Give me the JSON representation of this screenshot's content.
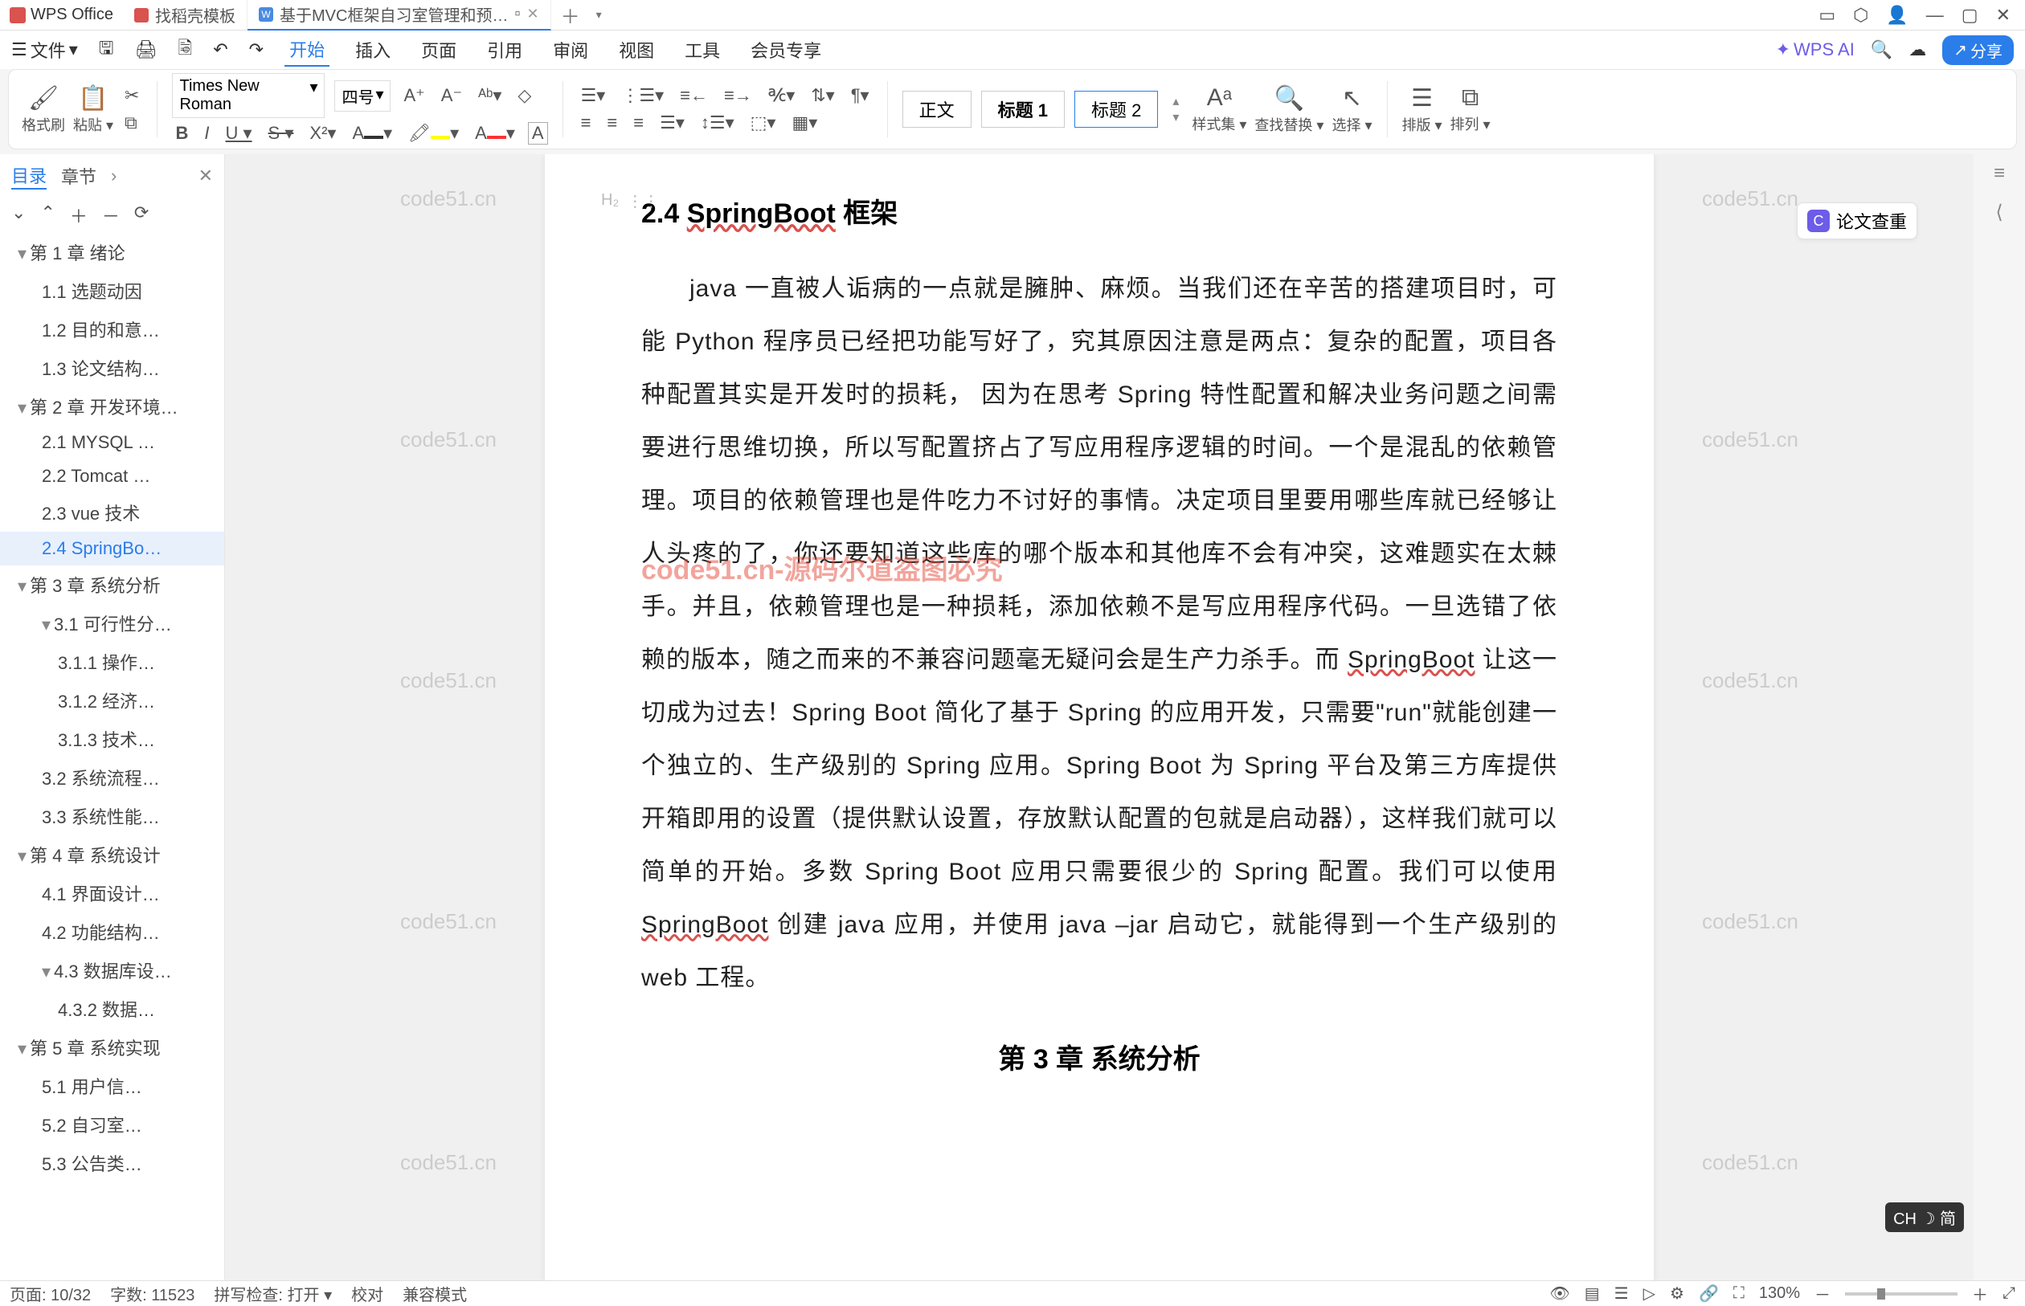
{
  "app": {
    "name": "WPS Office"
  },
  "tabs": [
    {
      "label": "找稻壳模板",
      "type": "d"
    },
    {
      "label": "基于MVC框架自习室管理和预…",
      "type": "w",
      "active": true
    }
  ],
  "windowControls": {
    "min": "—",
    "max": "▢",
    "close": "✕"
  },
  "menubar": {
    "file": "文件",
    "items": [
      "开始",
      "插入",
      "页面",
      "引用",
      "审阅",
      "视图",
      "工具",
      "会员专享"
    ],
    "active_index": 0,
    "wps_ai": "WPS AI",
    "share": "分享"
  },
  "ribbon": {
    "format_painter": "格式刷",
    "paste": "粘贴",
    "font_name": "Times New Roman",
    "font_size": "四号",
    "styles": {
      "body": "正文",
      "heading1": "标题 1",
      "heading2": "标题 2"
    },
    "styleset": "样式集",
    "find_replace": "查找替换",
    "select": "选择",
    "arrange": "排版",
    "order": "排列"
  },
  "sidebar": {
    "tabs": {
      "toc": "目录",
      "chapters": "章节"
    },
    "tree": [
      {
        "lvl": 0,
        "label": "第 1 章  绪论",
        "caret": true
      },
      {
        "lvl": 1,
        "label": "1.1 选题动因"
      },
      {
        "lvl": 1,
        "label": "1.2 目的和意…"
      },
      {
        "lvl": 1,
        "label": "1.3 论文结构…"
      },
      {
        "lvl": 0,
        "label": "第 2 章  开发环境…",
        "caret": true
      },
      {
        "lvl": 1,
        "label": "2.1 MYSQL …"
      },
      {
        "lvl": 1,
        "label": "2.2 Tomcat …"
      },
      {
        "lvl": 1,
        "label": "2.3 vue 技术"
      },
      {
        "lvl": 1,
        "label": "2.4 SpringBo…",
        "active": true
      },
      {
        "lvl": 0,
        "label": "第 3 章  系统分析",
        "caret": true
      },
      {
        "lvl": 1,
        "label": "3.1 可行性分…",
        "caret": true
      },
      {
        "lvl": 2,
        "label": "3.1.1 操作…"
      },
      {
        "lvl": 2,
        "label": "3.1.2 经济…"
      },
      {
        "lvl": 2,
        "label": "3.1.3 技术…"
      },
      {
        "lvl": 1,
        "label": "3.2 系统流程…"
      },
      {
        "lvl": 1,
        "label": "3.3 系统性能…"
      },
      {
        "lvl": 0,
        "label": "第 4 章  系统设计",
        "caret": true
      },
      {
        "lvl": 1,
        "label": "4.1 界面设计…"
      },
      {
        "lvl": 1,
        "label": "4.2 功能结构…"
      },
      {
        "lvl": 1,
        "label": "4.3 数据库设…",
        "caret": true
      },
      {
        "lvl": 2,
        "label": "4.3.2  数据…"
      },
      {
        "lvl": 0,
        "label": "第 5 章  系统实现",
        "caret": true
      },
      {
        "lvl": 1,
        "label": "5.1 用户信…"
      },
      {
        "lvl": 1,
        "label": "5.2 自习室…"
      },
      {
        "lvl": 1,
        "label": "5.3 公告类…"
      }
    ]
  },
  "document": {
    "heading_prefix": "2.4 ",
    "heading_underlined": "SpringBoot",
    "heading_suffix": " 框架",
    "body_p1a": "java 一直被人诟病的一点就是臃肿、麻烦。当我们还在辛苦的搭建项目时，可能 Python 程序员已经把功能写好了，究其原因注意是两点：复杂的配置，项目各种配置其实是开发时的损耗，  因为在思考 Spring  特性配置和解决业务问题之间需要进行思维切换，所以写配置挤占了写应用程序逻辑的时间。一个是混乱的依赖管理。项目的依赖管理也是件吃力不讨好的事情。决定项目里要用哪些库就已经够让人头疼的了，你还要知道这些库的哪个版本和其他库不会有冲突，这难题实在太棘手。并且，依赖管理也是一种损耗，添加依赖不是写应用程序代码。一旦选错了依赖的版本，随之而来的不兼容问题毫无疑问会是生产力杀手。而 ",
    "body_springboot": "SpringBoot",
    "body_p1b": " 让这一切成为过去！Spring Boot  简化了基于 Spring 的应用开发，只需要\"run\"就能创建一个独立的、生产级别的 Spring 应用。Spring Boot 为 Spring 平台及第三方库提供开箱即用的设置（提供默认设置，存放默认配置的包就是启动器），这样我们就可以简单的开始。多数 Spring Boot 应用只需要很少的 Spring 配置。我们可以使用 ",
    "body_springboot2": "SpringBoot",
    "body_p1c": " 创建 java 应用，并使用 java  –jar  启动它，就能得到一个生产级别的 web 工程。",
    "chapter3": "第 3 章  系统分析",
    "watermark": "code51.cn",
    "watermark_red": "code51.cn-源码尔道盗图必究"
  },
  "thesis_check": "论文查重",
  "ime": "CH ☽ 简",
  "statusbar": {
    "page": "页面: 10/32",
    "words": "字数: 11523",
    "spell": "拼写检查: 打开",
    "proof": "校对",
    "compat": "兼容模式",
    "zoom": "130%"
  }
}
